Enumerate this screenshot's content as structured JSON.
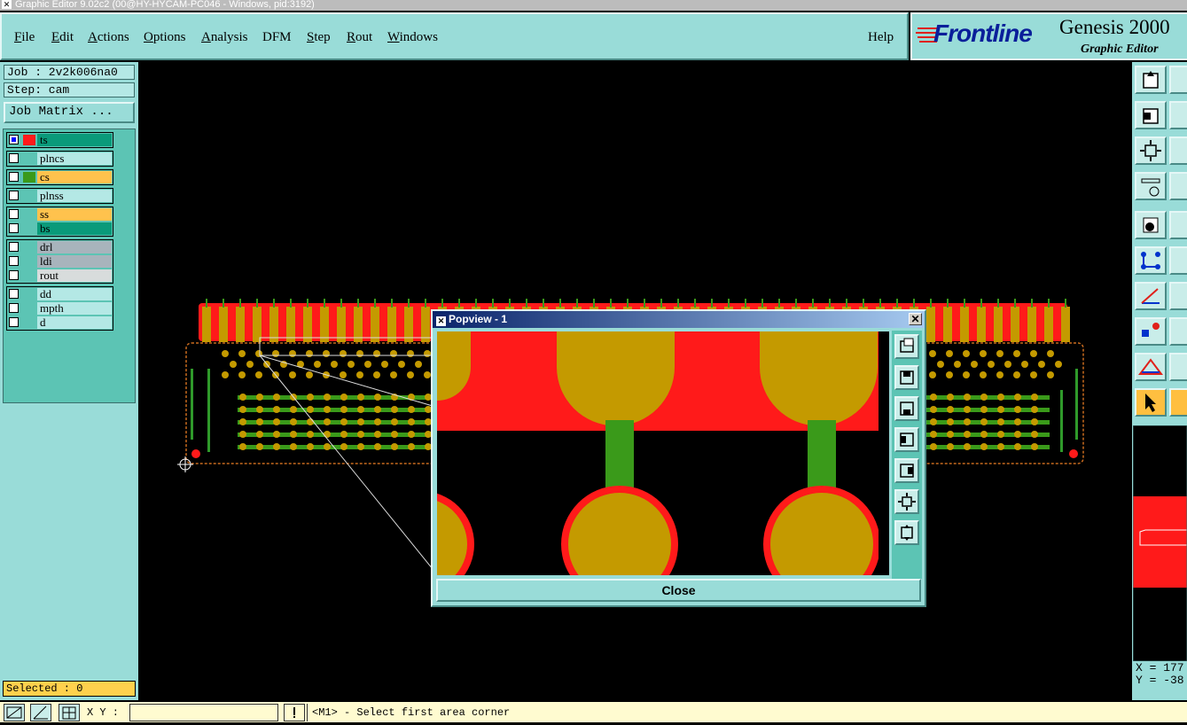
{
  "window": {
    "title": "Graphic Editor 9.02c2 (00@HY-HYCAM-PC046 - Windows, pid:3192)"
  },
  "menu": {
    "items": [
      {
        "label": "File",
        "underline": "F",
        "rest": "ile"
      },
      {
        "label": "Edit",
        "underline": "E",
        "rest": "dit"
      },
      {
        "label": "Actions",
        "underline": "A",
        "rest": "ctions"
      },
      {
        "label": "Options",
        "underline": "O",
        "rest": "ptions"
      },
      {
        "label": "Analysis",
        "underline": "A",
        "rest": "nalysis"
      },
      {
        "label": "DFM",
        "underline": "",
        "rest": "DFM"
      },
      {
        "label": "Step",
        "underline": "S",
        "rest": "tep"
      },
      {
        "label": "Rout",
        "underline": "R",
        "rest": "out"
      },
      {
        "label": "Windows",
        "underline": "W",
        "rest": "indows"
      }
    ],
    "help": "Help"
  },
  "brand": {
    "logo": "Frontline",
    "product": "Genesis 2000",
    "subtitle": "Graphic Editor"
  },
  "job": {
    "job_line": "Job : 2v2k006na0",
    "step_line": "Step: cam",
    "matrix_button": "Job Matrix ..."
  },
  "layers": [
    {
      "name": "ts",
      "color": "#0a9a7a",
      "chip": "#ff1a1a",
      "checked": true
    },
    {
      "name": "plncs",
      "color": "#b4e8e5",
      "chip": "",
      "checked": false
    },
    {
      "name": "cs",
      "color": "#ffc24d",
      "chip": "#3a9a1a",
      "checked": false
    },
    {
      "name": "plnss",
      "color": "#b4e8e5",
      "chip": "",
      "checked": false
    },
    {
      "name": "ss",
      "color": "#ffc24d",
      "chip": "",
      "checked": false
    },
    {
      "name": "bs",
      "color": "#0a9a7a",
      "chip": "",
      "checked": false
    },
    {
      "name": "drl",
      "color": "#a8b4bc",
      "chip": "",
      "checked": false
    },
    {
      "name": "ldi",
      "color": "#a8b4bc",
      "chip": "",
      "checked": false
    },
    {
      "name": "rout",
      "color": "#d8dcdc",
      "chip": "",
      "checked": false
    },
    {
      "name": "dd",
      "color": "#b4e8e5",
      "chip": "",
      "checked": false
    },
    {
      "name": "mpth",
      "color": "#b4e8e5",
      "chip": "",
      "checked": false
    },
    {
      "name": "d",
      "color": "#b4e8e5",
      "chip": "",
      "checked": false
    }
  ],
  "selected": "Selected : 0",
  "status": {
    "xy_label": "X Y :",
    "xy_value": "",
    "message": "<M1> - Select first area corner"
  },
  "popview": {
    "title": "Popview - 1",
    "close_label": "Close"
  },
  "coords": {
    "x": "X = 177",
    "y": "Y = -38"
  },
  "icons": {
    "popview_tools": [
      "zoom-window-icon",
      "pan-up-icon",
      "pan-down-icon",
      "pan-left-icon",
      "pan-right-icon",
      "zoom-fit-icon",
      "zoom-home-icon"
    ],
    "right_tools": [
      "zoom-in-icon",
      "zoom-out-icon",
      "fit-icon",
      "settings-icon",
      "add-pad-icon",
      "connect-icon",
      "angle-icon",
      "snap-icon",
      "measure-icon",
      "select-arrow-icon"
    ]
  }
}
